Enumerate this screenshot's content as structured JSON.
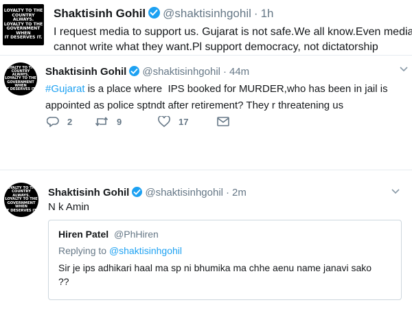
{
  "colors": {
    "accent": "#1da1f2",
    "muted": "#657786",
    "text": "#14171a",
    "border": "#e6ecf0"
  },
  "avatar_text": [
    "LOYALTY TO THE",
    "COUNTRY ALWAYS.",
    "LOYALTY TO THE",
    "GOVERNMENT WHEN",
    "IT DESERVES IT."
  ],
  "tweets": [
    {
      "name": "Shaktisinh Gohil",
      "handle": "@shaktisinhgohil",
      "time": "1h",
      "dot": "·",
      "line1": "I request media to support us. Gujarat is not safe.We all know.Even media",
      "line2": "cannot write what they want.Pl support democracy, not dictatorship"
    },
    {
      "name": "Shaktisinh Gohil",
      "handle": "@shaktisinhgohil",
      "time": "44m",
      "dot": "·",
      "hashtag": "#Gujarat",
      "line1_rest": " is a place where  IPS booked for MURDER,who has been in jail is",
      "line2": "appointed as police sptndt after retirement? They r threatening us",
      "actions": {
        "replies": "2",
        "retweets": "9",
        "likes": "17"
      }
    },
    {
      "name": "Shaktisinh Gohil",
      "handle": "@shaktisinhgohil",
      "time": "2m",
      "dot": "·",
      "text": "N k Amin",
      "quote": {
        "name": "Hiren Patel",
        "handle": "@PhHiren",
        "replying_prefix": "Replying to ",
        "replying_to": "@shaktisinhgohil",
        "line1": "Sir je ips adhikari haal ma sp ni bhumika ma chhe aenu name janavi sako",
        "line2": "??"
      }
    }
  ],
  "icons": [
    "verified-badge-icon",
    "chevron-down-icon",
    "reply-icon",
    "retweet-icon",
    "like-icon",
    "direct-message-icon"
  ]
}
